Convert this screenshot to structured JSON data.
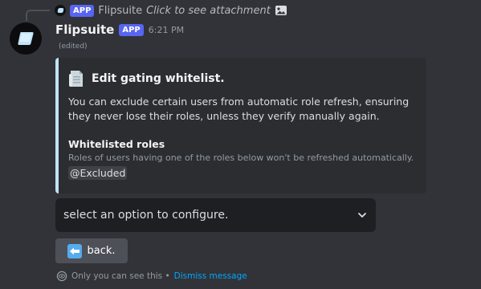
{
  "reply": {
    "app_tag": "APP",
    "author": "Flipsuite",
    "text": "Click to see attachment",
    "attachment_icon": "image-icon"
  },
  "message": {
    "username": "Flipsuite",
    "app_tag": "APP",
    "timestamp": "6:21 PM",
    "edited": "(edited)",
    "avatar_icon": "flipsuite-logo-icon"
  },
  "embed": {
    "accent_color": "#bfe3f7",
    "icon": "document-icon",
    "title": "Edit gating whitelist.",
    "description": "You can exclude certain users from automatic role refresh, ensuring they never lose their roles, unless they verify manually again.",
    "field_name": "Whitelisted roles",
    "field_description": "Roles of users having one of the roles below won't be refreshed automatically.",
    "role_mention": "@Excluded"
  },
  "select": {
    "placeholder": "select an option to configure.",
    "icon": "chevron-down-icon"
  },
  "back_button": {
    "label": "back.",
    "icon": "left-arrow-icon"
  },
  "footer": {
    "notice": "Only you can see this •",
    "dismiss": "Dismiss message",
    "icon": "eye-icon"
  },
  "colors": {
    "background": "#313338",
    "embed_background": "#2b2d31",
    "brand": "#5865f2",
    "link": "#00a8fc"
  }
}
